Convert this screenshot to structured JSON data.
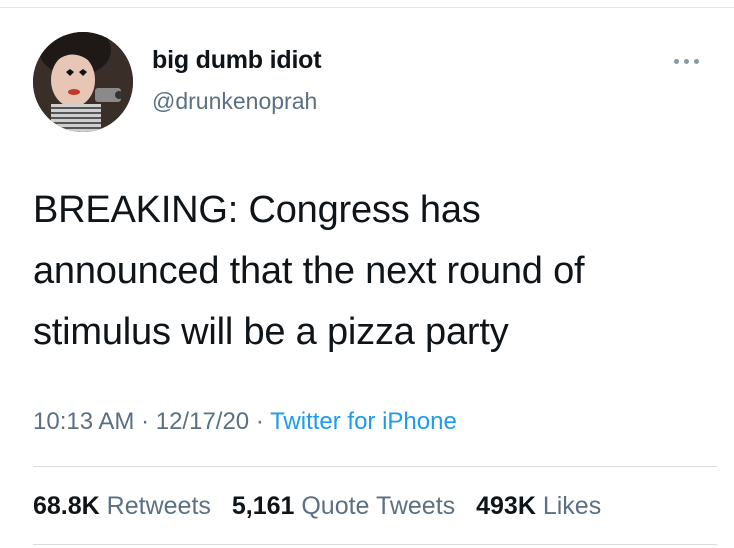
{
  "tweet": {
    "display_name": "big dumb idiot",
    "handle": "@drunkenoprah",
    "more_icon": "more-horizontal-icon",
    "text_lines": [
      "BREAKING: Congress has",
      "announced that the next round of",
      "stimulus will be a pizza party"
    ],
    "time": "10:13 AM",
    "separator": " · ",
    "date": "12/17/20",
    "source": "Twitter for iPhone",
    "stats": {
      "retweets_count": "68.8K",
      "retweets_label": "Retweets",
      "quote_count": "5,161",
      "quote_label": "Quote Tweets",
      "likes_count": "493K",
      "likes_label": "Likes"
    }
  },
  "colors": {
    "text": "#0f1419",
    "secondary": "#5b7083",
    "link": "#1d9bf0",
    "divider": "#d9dde1"
  }
}
